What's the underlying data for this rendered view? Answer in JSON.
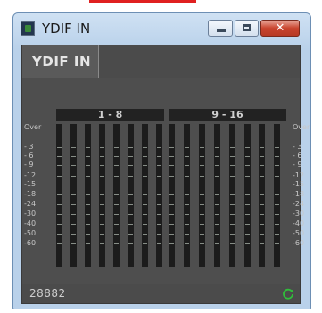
{
  "window": {
    "title": "YDIF IN"
  },
  "tab": {
    "label": "YDIF IN"
  },
  "groups": [
    {
      "label": "1 - 8"
    },
    {
      "label": "9 - 16"
    }
  ],
  "scale": [
    "Over",
    "- 3",
    "- 6",
    "- 9",
    "-12",
    "-15",
    "-18",
    "-24",
    "-30",
    "-40",
    "-50",
    "-60"
  ],
  "meters": {
    "count": 16,
    "levels": [
      0,
      0,
      0,
      0,
      0,
      0,
      0,
      0,
      0,
      0,
      0,
      0,
      0,
      0,
      0,
      0
    ]
  },
  "status": {
    "id": "28882"
  },
  "colors": {
    "panel": "#4e4e4e",
    "meter_bg": "#1c1c1c",
    "sync_icon": "#2fbf3a"
  },
  "icons": {
    "app": "app-icon",
    "minimize": "minimize-icon",
    "maximize": "maximize-icon",
    "close": "close-icon",
    "sync": "sync-icon"
  }
}
